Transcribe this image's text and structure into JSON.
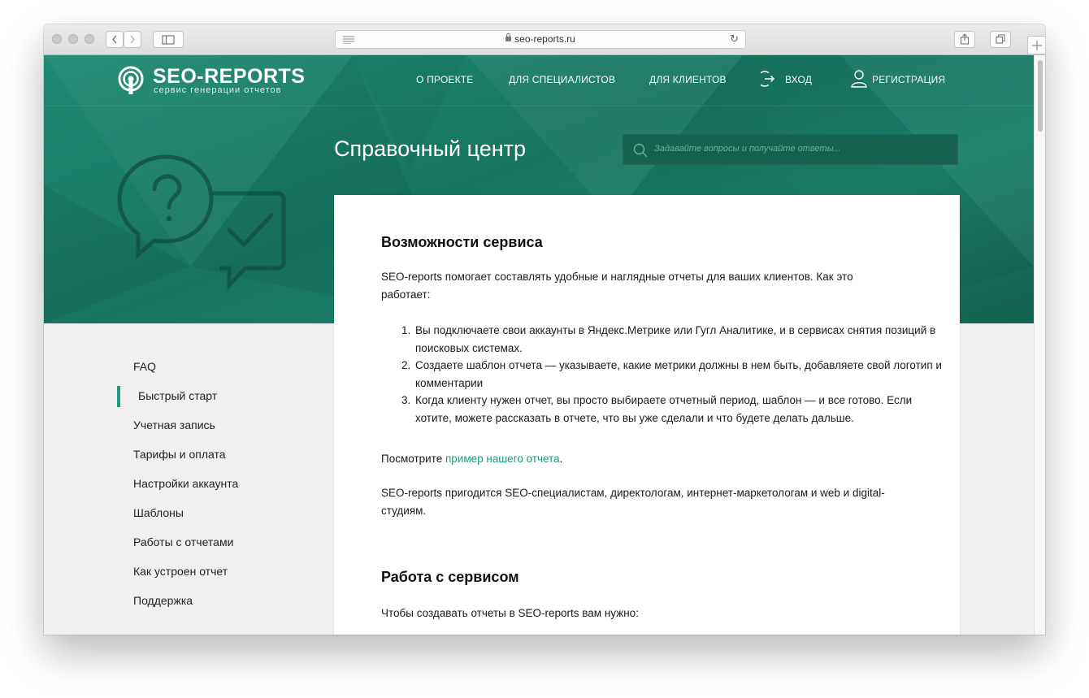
{
  "browser": {
    "url": "seo-reports.ru"
  },
  "nav": {
    "logo_title": "SEO-REPORTS",
    "logo_subtitle": "сервис генерации отчетов",
    "links": [
      "О ПРОЕКТЕ",
      "ДЛЯ СПЕЦИАЛИСТОВ",
      "ДЛЯ КЛИЕНТОВ"
    ],
    "login": "ВХОД",
    "register": "РЕГИСТРАЦИЯ"
  },
  "hero": {
    "title": "Справочный центр",
    "search_placeholder": "Задавайте вопросы и получайте ответы..."
  },
  "sidebar": {
    "items": [
      {
        "label": "FAQ"
      },
      {
        "label": "Быстрый старт",
        "active": true
      },
      {
        "label": "Учетная запись"
      },
      {
        "label": "Тарифы и оплата"
      },
      {
        "label": "Настройки аккаунта"
      },
      {
        "label": "Шаблоны"
      },
      {
        "label": "Работы с отчетами"
      },
      {
        "label": "Как устроен отчет"
      },
      {
        "label": "Поддержка"
      }
    ]
  },
  "article": {
    "section1_title": "Возможности сервиса",
    "intro": "SEO-reports помогает составлять удобные и наглядные отчеты для ваших клиентов. Как это работает:",
    "steps": [
      "Вы подключаете свои аккаунты в Яндекс.Метрике или Гугл Аналитике, и в сервисах снятия позиций в поисковых системах.",
      "Создаете шаблон отчета — указываете, какие метрики должны в нем быть, добавляете свой логотип и комментарии",
      "Когда клиенту нужен отчет, вы просто выбираете отчетный период, шаблон — и все готово. Если хотите, можете рассказать в отчете, что вы уже сделали и что будете делать дальше."
    ],
    "example_prefix": "Посмотрите ",
    "example_link": "пример нашего отчета",
    "example_suffix": ".",
    "audience": "SEO-reports пригодится SEO-специалистам, директологам, интернет-маркетологам и web и digital-студиям.",
    "section2_title": "Работа с сервисом",
    "section2_intro": "Чтобы создавать отчеты в SEO-reports вам нужно:"
  },
  "colors": {
    "brand_green": "#1b806a",
    "accent": "#1e9a80"
  }
}
